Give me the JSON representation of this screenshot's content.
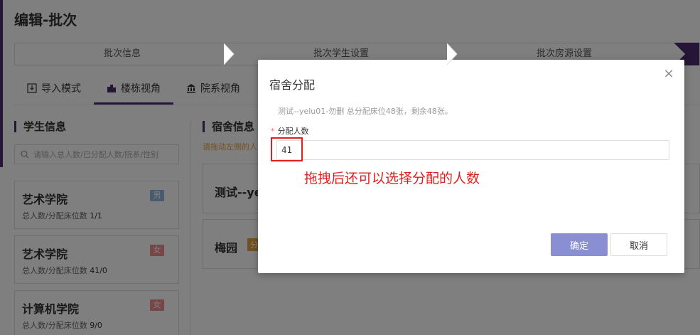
{
  "page": {
    "title": "编辑-批次",
    "steps": [
      "批次信息",
      "批次学生设置",
      "批次房源设置"
    ],
    "view_tabs": [
      {
        "label": "导入模式",
        "icon": "import-icon"
      },
      {
        "label": "楼栋视角",
        "icon": "building-icon"
      },
      {
        "label": "院系视角",
        "icon": "bank-icon"
      }
    ],
    "active_view_tab": "楼栋视角"
  },
  "students": {
    "title": "学生信息",
    "search_placeholder": "请输入总人数/已分配人数/院系/性别",
    "meta_label": "总人数/分配床位数",
    "colleges": [
      {
        "name": "艺术学院",
        "gender": "男",
        "count": "1/1"
      },
      {
        "name": "艺术学院",
        "gender": "女",
        "count": "41/0"
      },
      {
        "name": "计算机学院",
        "gender": "女",
        "count": "9/0"
      }
    ]
  },
  "dorms": {
    "title": "宿舍信息",
    "hint": "请拖动左侧的人",
    "items": [
      {
        "name": "测试--ye"
      },
      {
        "name": "梅园",
        "tag": "分"
      }
    ]
  },
  "modal": {
    "title": "宿舍分配",
    "close_glyph": "×",
    "info": "测试--yelu01-勿删 总分配床位48张，剩余48张。",
    "field_required_mark": "*",
    "field_label": "分配人数",
    "field_value": "41",
    "annotation": "拖拽后还可以选择分配的人数",
    "confirm_label": "确定",
    "cancel_label": "取消"
  },
  "colors": {
    "brand": "#4b2a6e",
    "confirm_button": "#8a8fd4",
    "annotation_red": "#e02020",
    "badge_male": "#8fb8e0",
    "badge_female": "#f08c8c",
    "warning": "#e6a23c"
  }
}
